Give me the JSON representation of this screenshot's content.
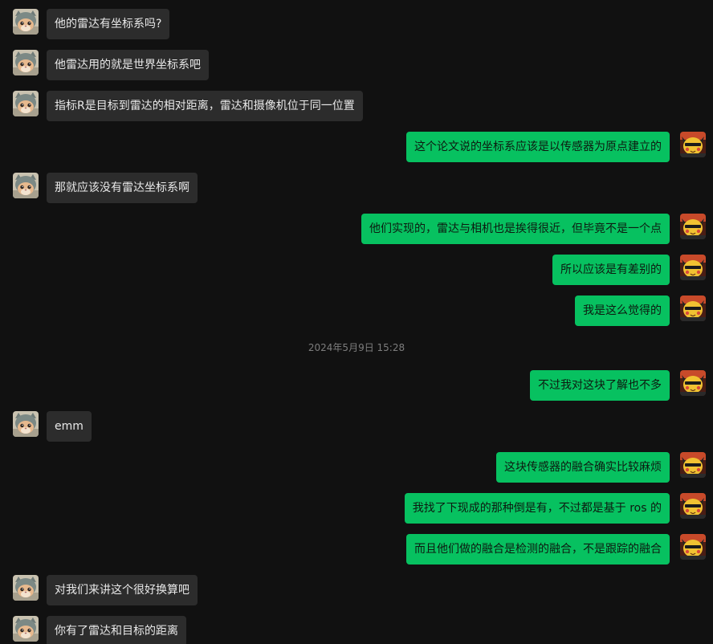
{
  "messages": [
    {
      "side": "in",
      "text": "他的雷达有坐标系吗?"
    },
    {
      "side": "in",
      "text": "他雷达用的就是世界坐标系吧"
    },
    {
      "side": "in",
      "text": "指标R是目标到雷达的相对距离，雷达和摄像机位于同一位置"
    },
    {
      "side": "out",
      "text": "这个论文说的坐标系应该是以传感器为原点建立的"
    },
    {
      "side": "in",
      "text": "那就应该没有雷达坐标系啊"
    },
    {
      "side": "out",
      "text": "他们实现的，雷达与相机也是挨得很近，但毕竟不是一个点"
    },
    {
      "side": "out",
      "text": "所以应该是有差别的"
    },
    {
      "side": "out",
      "text": "我是这么觉得的"
    },
    {
      "side": "time",
      "text": "2024年5月9日 15:28"
    },
    {
      "side": "out",
      "text": "不过我对这块了解也不多"
    },
    {
      "side": "in",
      "text": "emm"
    },
    {
      "side": "out",
      "text": "这块传感器的融合确实比较麻烦"
    },
    {
      "side": "out",
      "text": "我找了下现成的那种倒是有，不过都是基于 ros 的"
    },
    {
      "side": "out",
      "text": "而且他们做的融合是检测的融合，不是跟踪的融合"
    },
    {
      "side": "in",
      "text": "对我们来讲这个很好换算吧"
    },
    {
      "side": "in",
      "text": "你有了雷达和目标的距离"
    }
  ],
  "colors": {
    "background": "#111111",
    "incoming_bubble": "#2c2c2c",
    "outgoing_bubble": "#07c160",
    "timestamp": "#7d7d7d"
  },
  "icons": {
    "incoming_avatar": "cat-avatar-icon",
    "outgoing_avatar": "pikachu-avatar-icon"
  }
}
